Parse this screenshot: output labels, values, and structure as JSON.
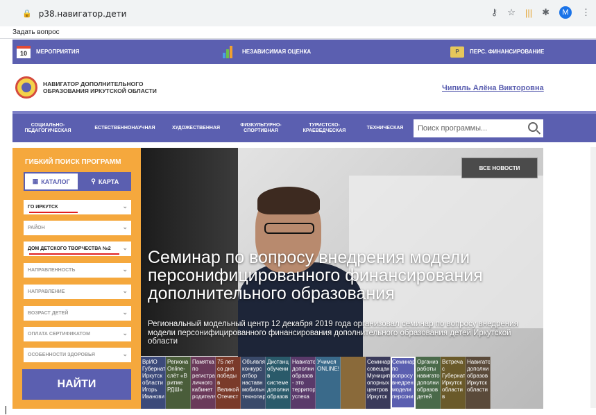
{
  "browser": {
    "url": "p38.навигатор.дети",
    "avatar": "M"
  },
  "bookmarks": {
    "ask": "Задать вопрос"
  },
  "topnav": {
    "calendar_day": "10",
    "events": "Мероприятия",
    "assessment": "Независимая оценка",
    "financing": "Перс. финансирование",
    "money_icon_text": "P"
  },
  "header": {
    "org_line1": "Навигатор дополнительного",
    "org_line2": "образования Иркутской области",
    "user": "Чипиль Алёна Викторовна"
  },
  "categories": [
    {
      "line1": "Социально-",
      "line2": "педагогическая"
    },
    {
      "line1": "Естественнонаучная",
      "line2": ""
    },
    {
      "line1": "Художественная",
      "line2": ""
    },
    {
      "line1": "Физкультурно-",
      "line2": "спортивная"
    },
    {
      "line1": "Туристско-",
      "line2": "краеведческая"
    },
    {
      "line1": "Техническая",
      "line2": ""
    }
  ],
  "search": {
    "placeholder": "Поиск программы..."
  },
  "filter": {
    "title": "Гибкий поиск программ",
    "catalog": "Каталог",
    "map": "Карта",
    "selects": [
      "ГО Иркутск",
      "Район",
      "Дом детского творчества №2",
      "Направленность",
      "Направление",
      "Возраст детей",
      "Оплата сертификатом",
      "Особенности здоровья"
    ],
    "find": "Найти"
  },
  "hero": {
    "all_news": "Все новости",
    "title": "Семинар по вопросу внедрения модели персонифицированного финансирования дополнительного образования",
    "desc": "Региональный модельный центр 12 декабря 2019 года организовал семинар по вопросу внедрения модели персонифицированного финансирования дополнительного образования детей Иркутской области"
  },
  "thumbs": [
    {
      "text": "ВрИО Губернат Иркутск области Игорь Иванови",
      "color": "#3c4a7a"
    },
    {
      "text": "Региона Online- слёт «В ритме РДШ»",
      "color": "#4a5d3a"
    },
    {
      "text": "Памятка по регистра личного кабинет родителя",
      "color": "#6a3a5a"
    },
    {
      "text": "75 лет со дня победы в Великой Отечест",
      "color": "#7a3a2a"
    },
    {
      "text": "Объявля конкурс отбор наставн мобильн технопар",
      "color": "#3a4a6a"
    },
    {
      "text": "Дистанц обучени в системе дополни образов",
      "color": "#2a5a6a"
    },
    {
      "text": "Навигато дополни образов - это территор успеха",
      "color": "#5a3a6a"
    },
    {
      "text": "Учимся ONLINE!",
      "color": "#3a6a8a"
    },
    {
      "text": "",
      "color": "#8a6a3a"
    },
    {
      "text": "Семинар совещан Муницип опорных центров Иркутск",
      "color": "#3a3a5a"
    },
    {
      "text": "Семинар по вопросу внедрен модели персони",
      "color": "#5b5fb0"
    },
    {
      "text": "Организ работы навигато дополни образов детей",
      "color": "#4a6a4a"
    },
    {
      "text": "Встреча с Губернат Иркутск области в",
      "color": "#6a5a2a"
    },
    {
      "text": "Навигато дополни образов Иркутск области",
      "color": "#5a4a3a"
    }
  ]
}
